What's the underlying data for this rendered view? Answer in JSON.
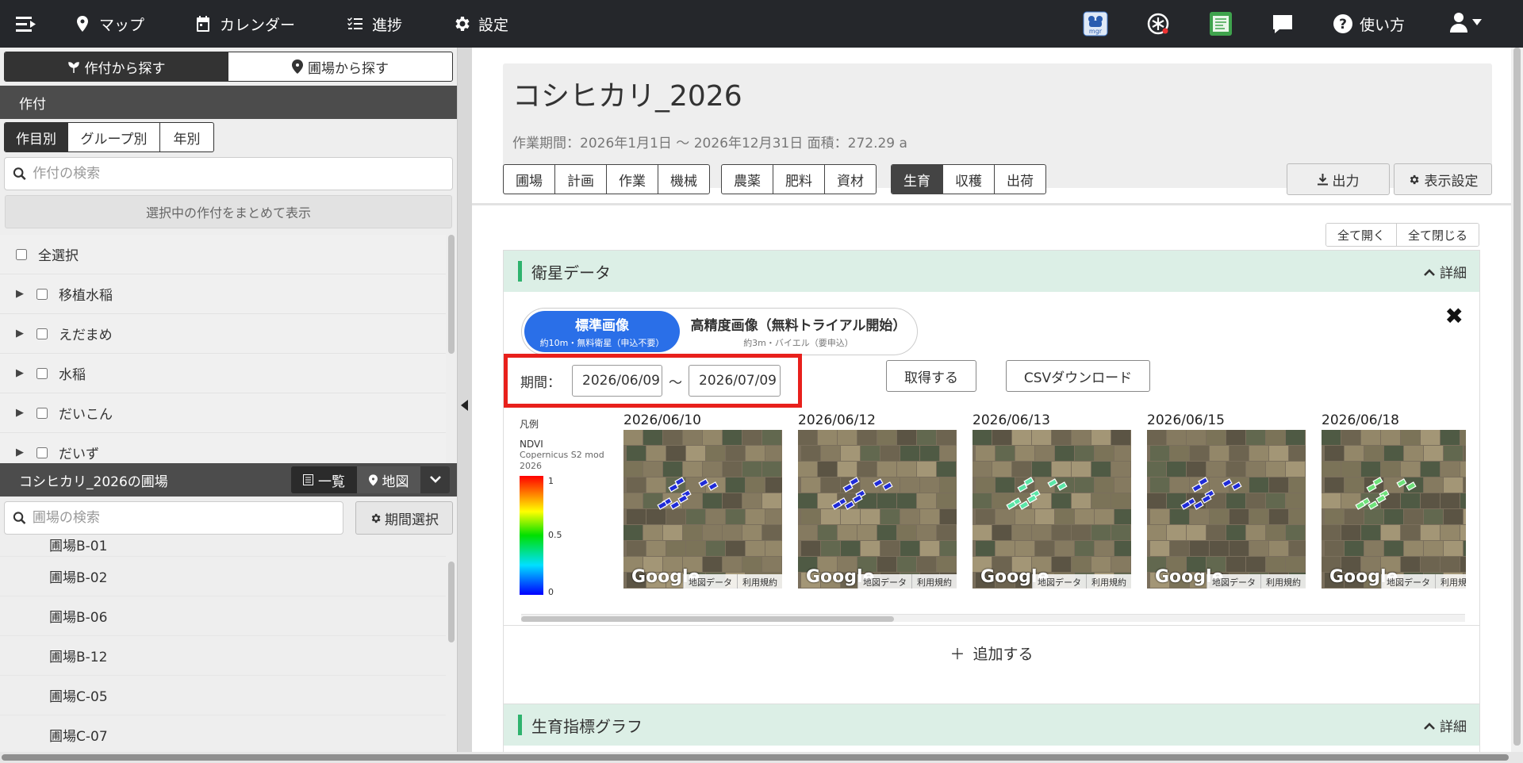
{
  "nav": {
    "items": [
      {
        "label": "マップ",
        "icon": "map-pin-icon"
      },
      {
        "label": "カレンダー",
        "icon": "calendar-icon"
      },
      {
        "label": "進捗",
        "icon": "checklist-icon"
      },
      {
        "label": "設定",
        "icon": "gear-icon"
      }
    ],
    "help_label": "使い方",
    "header_icons": [
      "agri-mgr-icon",
      "alert-icon",
      "report-icon",
      "chat-icon"
    ],
    "mgr_badge": "mgr"
  },
  "left": {
    "search_mode": {
      "by_crop": "作付から探す",
      "by_field": "圃場から探す"
    },
    "crop_section_title": "作付",
    "crop_tabs": [
      "作目別",
      "グループ別",
      "年別"
    ],
    "crop_search_placeholder": "作付の検索",
    "bulk_show_label": "選択中の作付をまとめて表示",
    "select_all_label": "全選択",
    "crops": [
      "移植水稲",
      "えだまめ",
      "水稲",
      "だいこん",
      "だいず"
    ],
    "field_section_title": "コシヒカリ_2026の圃場",
    "view_list_label": "一覧",
    "view_map_label": "地図",
    "field_search_placeholder": "圃場の検索",
    "period_select_label": "期間選択",
    "fields": [
      "圃場B-01",
      "圃場B-02",
      "圃場B-06",
      "圃場B-12",
      "圃場C-05",
      "圃場C-07"
    ]
  },
  "main": {
    "title": "コシヒカリ_2026",
    "meta": "作業期間：2026年1月1日 〜 2026年12月31日  面積：272.29 a",
    "tab_groups": [
      [
        "圃場",
        "計画",
        "作業",
        "機械"
      ],
      [
        "農薬",
        "肥料",
        "資材"
      ],
      [
        "生育",
        "収穫",
        "出荷"
      ]
    ],
    "active_tab": "生育",
    "export_label": "出力",
    "display_settings_label": "表示設定",
    "expand_all_label": "全て開く",
    "collapse_all_label": "全て閉じる",
    "detail_label": "詳細"
  },
  "satellite": {
    "title": "衛星データ",
    "standard_label": "標準画像",
    "standard_sub": "約10m・無料衛星（申込不要）",
    "high_label": "高精度画像（無料トライアル開始）",
    "high_sub": "約3m・バイエル（要申込）",
    "period_label": "期間：",
    "date_from": "2026/06/09",
    "date_sep": "〜",
    "date_to": "2026/07/09",
    "fetch_label": "取得する",
    "csv_label": "CSVダウンロード",
    "legend_title": "凡例",
    "legend_index": "NDVI",
    "legend_source": "Copernicus S2 mod 2026",
    "legend_ticks": [
      "1",
      "0.5",
      "0"
    ],
    "images": [
      {
        "date": "2026/06/10",
        "ndvi_tone": "#1f2bd8"
      },
      {
        "date": "2026/06/12",
        "ndvi_tone": "#1f2bd8"
      },
      {
        "date": "2026/06/13",
        "ndvi_tone": "#5be6a8"
      },
      {
        "date": "2026/06/15",
        "ndvi_tone": "#1f2bd8"
      },
      {
        "date": "2026/06/18",
        "ndvi_tone": "#6ee27a"
      }
    ],
    "map_brand": "Google",
    "map_data_label": "地図データ",
    "map_terms_label": "利用規約",
    "add_label": "追加する"
  },
  "growth_graph": {
    "title": "生育指標グラフ"
  },
  "colors": {
    "nav_bg": "#25272b",
    "accent_blue": "#2a6fe8",
    "highlight_red": "#e8201c",
    "panel_green": "#dcefe6"
  }
}
